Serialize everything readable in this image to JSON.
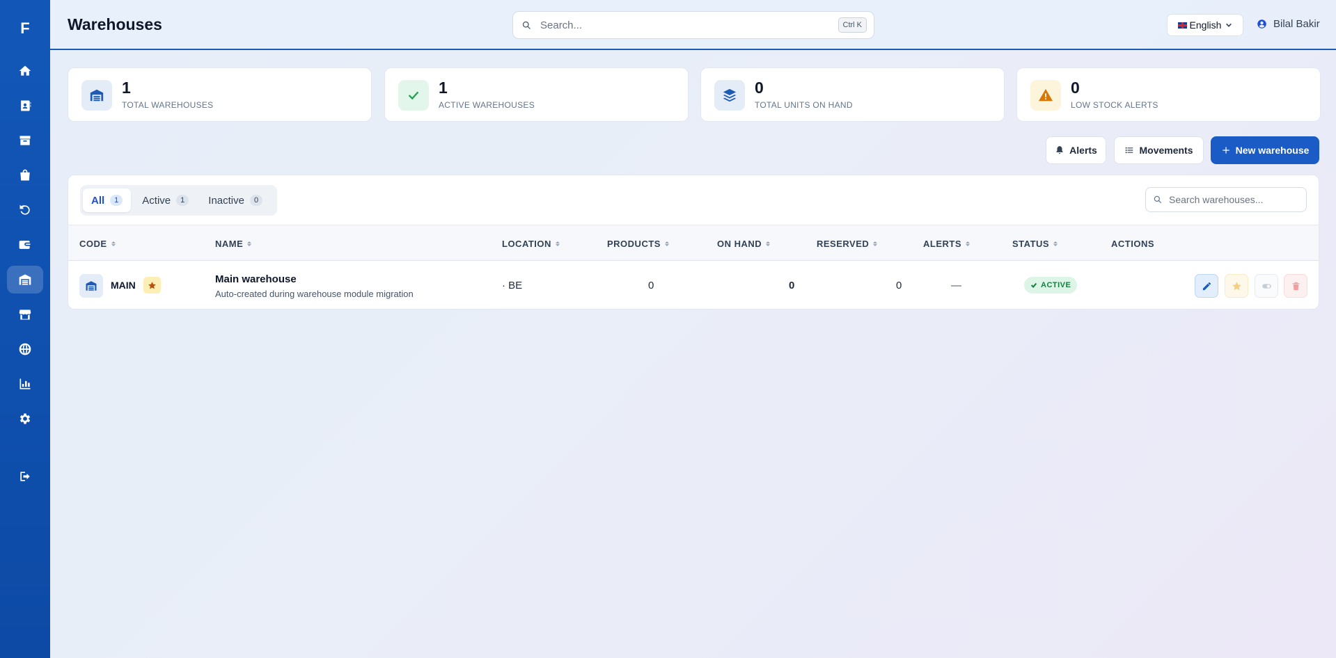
{
  "sidebar": {
    "logo": "F",
    "items": [
      {
        "icon": "home-icon"
      },
      {
        "icon": "address-book-icon"
      },
      {
        "icon": "box-icon"
      },
      {
        "icon": "bag-icon"
      },
      {
        "icon": "undo-icon"
      },
      {
        "icon": "wallet-icon"
      },
      {
        "icon": "warehouse-icon",
        "active": true
      },
      {
        "icon": "store-icon"
      },
      {
        "icon": "globe-icon"
      },
      {
        "icon": "chart-icon"
      },
      {
        "icon": "gear-icon"
      }
    ],
    "logout_icon": "logout-icon"
  },
  "header": {
    "title": "Warehouses",
    "search_placeholder": "Search...",
    "search_shortcut": "Ctrl K",
    "language": "English",
    "user_name": "Bilal Bakir"
  },
  "stats": [
    {
      "value": "1",
      "label": "TOTAL WAREHOUSES",
      "icon": "warehouse-icon",
      "color": "#1d5bb5"
    },
    {
      "value": "1",
      "label": "ACTIVE WAREHOUSES",
      "icon": "check-icon",
      "color": "#16a34a"
    },
    {
      "value": "0",
      "label": "TOTAL UNITS ON HAND",
      "icon": "layers-icon",
      "color": "#1d5bb5"
    },
    {
      "value": "0",
      "label": "LOW STOCK ALERTS",
      "icon": "warning-icon",
      "color": "#d97706"
    }
  ],
  "actions": {
    "alerts_label": "Alerts",
    "movements_label": "Movements",
    "new_label": "New warehouse"
  },
  "filters": {
    "tabs": [
      {
        "label": "All",
        "count": "1",
        "active": true
      },
      {
        "label": "Active",
        "count": "1"
      },
      {
        "label": "Inactive",
        "count": "0"
      }
    ],
    "search_placeholder": "Search warehouses..."
  },
  "table": {
    "headers": {
      "code": "CODE",
      "name": "NAME",
      "location": "LOCATION",
      "products": "PRODUCTS",
      "on_hand": "ON HAND",
      "reserved": "RESERVED",
      "alerts": "ALERTS",
      "status": "STATUS",
      "actions": "ACTIONS"
    },
    "rows": [
      {
        "code": "MAIN",
        "default": true,
        "name": "Main warehouse",
        "description": "Auto-created during warehouse module migration",
        "location": "· BE",
        "products": "0",
        "on_hand": "0",
        "reserved": "0",
        "alerts": "—",
        "status": "ACTIVE"
      }
    ]
  },
  "colors": {
    "primary": "#1a5bc6",
    "sidebar": "#1257b8",
    "success": "#15803d",
    "warning": "#d97706",
    "danger": "#ef4444"
  }
}
